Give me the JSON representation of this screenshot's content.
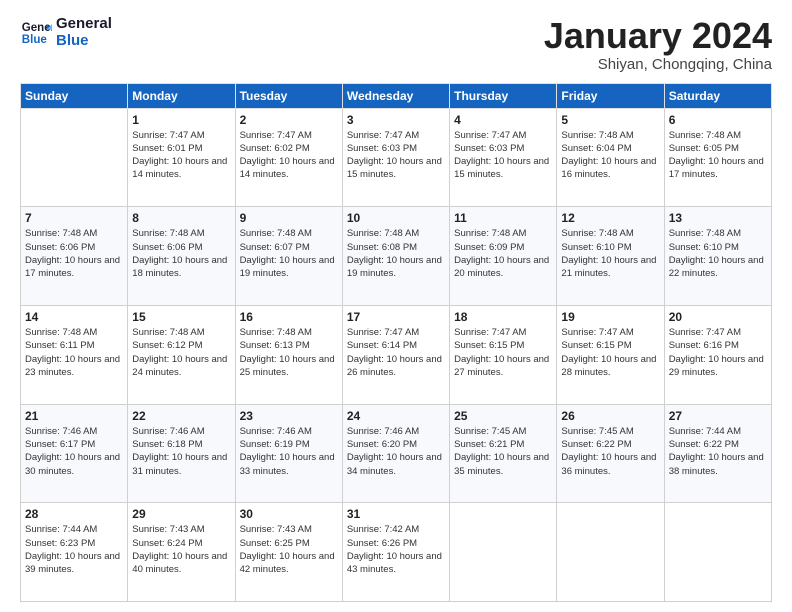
{
  "header": {
    "logo_general": "General",
    "logo_blue": "Blue",
    "month_title": "January 2024",
    "location": "Shiyan, Chongqing, China"
  },
  "days_of_week": [
    "Sunday",
    "Monday",
    "Tuesday",
    "Wednesday",
    "Thursday",
    "Friday",
    "Saturday"
  ],
  "weeks": [
    [
      {
        "day": "",
        "sunrise": "",
        "sunset": "",
        "daylight": ""
      },
      {
        "day": "1",
        "sunrise": "Sunrise: 7:47 AM",
        "sunset": "Sunset: 6:01 PM",
        "daylight": "Daylight: 10 hours and 14 minutes."
      },
      {
        "day": "2",
        "sunrise": "Sunrise: 7:47 AM",
        "sunset": "Sunset: 6:02 PM",
        "daylight": "Daylight: 10 hours and 14 minutes."
      },
      {
        "day": "3",
        "sunrise": "Sunrise: 7:47 AM",
        "sunset": "Sunset: 6:03 PM",
        "daylight": "Daylight: 10 hours and 15 minutes."
      },
      {
        "day": "4",
        "sunrise": "Sunrise: 7:47 AM",
        "sunset": "Sunset: 6:03 PM",
        "daylight": "Daylight: 10 hours and 15 minutes."
      },
      {
        "day": "5",
        "sunrise": "Sunrise: 7:48 AM",
        "sunset": "Sunset: 6:04 PM",
        "daylight": "Daylight: 10 hours and 16 minutes."
      },
      {
        "day": "6",
        "sunrise": "Sunrise: 7:48 AM",
        "sunset": "Sunset: 6:05 PM",
        "daylight": "Daylight: 10 hours and 17 minutes."
      }
    ],
    [
      {
        "day": "7",
        "sunrise": "Sunrise: 7:48 AM",
        "sunset": "Sunset: 6:06 PM",
        "daylight": "Daylight: 10 hours and 17 minutes."
      },
      {
        "day": "8",
        "sunrise": "Sunrise: 7:48 AM",
        "sunset": "Sunset: 6:06 PM",
        "daylight": "Daylight: 10 hours and 18 minutes."
      },
      {
        "day": "9",
        "sunrise": "Sunrise: 7:48 AM",
        "sunset": "Sunset: 6:07 PM",
        "daylight": "Daylight: 10 hours and 19 minutes."
      },
      {
        "day": "10",
        "sunrise": "Sunrise: 7:48 AM",
        "sunset": "Sunset: 6:08 PM",
        "daylight": "Daylight: 10 hours and 19 minutes."
      },
      {
        "day": "11",
        "sunrise": "Sunrise: 7:48 AM",
        "sunset": "Sunset: 6:09 PM",
        "daylight": "Daylight: 10 hours and 20 minutes."
      },
      {
        "day": "12",
        "sunrise": "Sunrise: 7:48 AM",
        "sunset": "Sunset: 6:10 PM",
        "daylight": "Daylight: 10 hours and 21 minutes."
      },
      {
        "day": "13",
        "sunrise": "Sunrise: 7:48 AM",
        "sunset": "Sunset: 6:10 PM",
        "daylight": "Daylight: 10 hours and 22 minutes."
      }
    ],
    [
      {
        "day": "14",
        "sunrise": "Sunrise: 7:48 AM",
        "sunset": "Sunset: 6:11 PM",
        "daylight": "Daylight: 10 hours and 23 minutes."
      },
      {
        "day": "15",
        "sunrise": "Sunrise: 7:48 AM",
        "sunset": "Sunset: 6:12 PM",
        "daylight": "Daylight: 10 hours and 24 minutes."
      },
      {
        "day": "16",
        "sunrise": "Sunrise: 7:48 AM",
        "sunset": "Sunset: 6:13 PM",
        "daylight": "Daylight: 10 hours and 25 minutes."
      },
      {
        "day": "17",
        "sunrise": "Sunrise: 7:47 AM",
        "sunset": "Sunset: 6:14 PM",
        "daylight": "Daylight: 10 hours and 26 minutes."
      },
      {
        "day": "18",
        "sunrise": "Sunrise: 7:47 AM",
        "sunset": "Sunset: 6:15 PM",
        "daylight": "Daylight: 10 hours and 27 minutes."
      },
      {
        "day": "19",
        "sunrise": "Sunrise: 7:47 AM",
        "sunset": "Sunset: 6:15 PM",
        "daylight": "Daylight: 10 hours and 28 minutes."
      },
      {
        "day": "20",
        "sunrise": "Sunrise: 7:47 AM",
        "sunset": "Sunset: 6:16 PM",
        "daylight": "Daylight: 10 hours and 29 minutes."
      }
    ],
    [
      {
        "day": "21",
        "sunrise": "Sunrise: 7:46 AM",
        "sunset": "Sunset: 6:17 PM",
        "daylight": "Daylight: 10 hours and 30 minutes."
      },
      {
        "day": "22",
        "sunrise": "Sunrise: 7:46 AM",
        "sunset": "Sunset: 6:18 PM",
        "daylight": "Daylight: 10 hours and 31 minutes."
      },
      {
        "day": "23",
        "sunrise": "Sunrise: 7:46 AM",
        "sunset": "Sunset: 6:19 PM",
        "daylight": "Daylight: 10 hours and 33 minutes."
      },
      {
        "day": "24",
        "sunrise": "Sunrise: 7:46 AM",
        "sunset": "Sunset: 6:20 PM",
        "daylight": "Daylight: 10 hours and 34 minutes."
      },
      {
        "day": "25",
        "sunrise": "Sunrise: 7:45 AM",
        "sunset": "Sunset: 6:21 PM",
        "daylight": "Daylight: 10 hours and 35 minutes."
      },
      {
        "day": "26",
        "sunrise": "Sunrise: 7:45 AM",
        "sunset": "Sunset: 6:22 PM",
        "daylight": "Daylight: 10 hours and 36 minutes."
      },
      {
        "day": "27",
        "sunrise": "Sunrise: 7:44 AM",
        "sunset": "Sunset: 6:22 PM",
        "daylight": "Daylight: 10 hours and 38 minutes."
      }
    ],
    [
      {
        "day": "28",
        "sunrise": "Sunrise: 7:44 AM",
        "sunset": "Sunset: 6:23 PM",
        "daylight": "Daylight: 10 hours and 39 minutes."
      },
      {
        "day": "29",
        "sunrise": "Sunrise: 7:43 AM",
        "sunset": "Sunset: 6:24 PM",
        "daylight": "Daylight: 10 hours and 40 minutes."
      },
      {
        "day": "30",
        "sunrise": "Sunrise: 7:43 AM",
        "sunset": "Sunset: 6:25 PM",
        "daylight": "Daylight: 10 hours and 42 minutes."
      },
      {
        "day": "31",
        "sunrise": "Sunrise: 7:42 AM",
        "sunset": "Sunset: 6:26 PM",
        "daylight": "Daylight: 10 hours and 43 minutes."
      },
      {
        "day": "",
        "sunrise": "",
        "sunset": "",
        "daylight": ""
      },
      {
        "day": "",
        "sunrise": "",
        "sunset": "",
        "daylight": ""
      },
      {
        "day": "",
        "sunrise": "",
        "sunset": "",
        "daylight": ""
      }
    ]
  ]
}
